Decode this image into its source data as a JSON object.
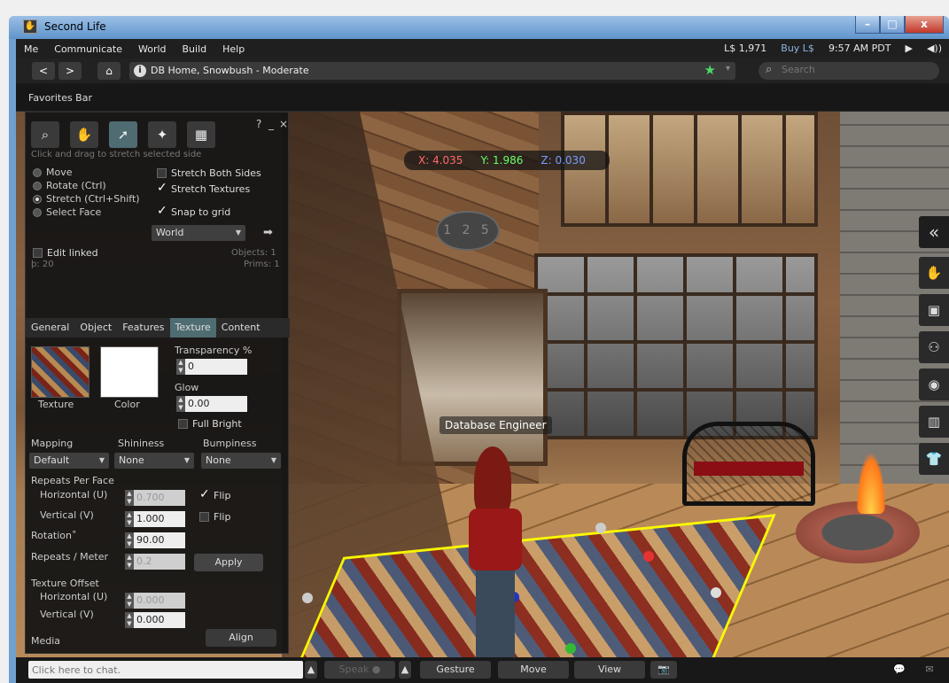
{
  "window": {
    "title": "Second Life",
    "app_icon": "second-life-hand-icon",
    "minimize": "–",
    "maximize": "□",
    "close": "x"
  },
  "menu": {
    "items": [
      "Me",
      "Communicate",
      "World",
      "Build",
      "Help"
    ],
    "balance": "L$ 1,971",
    "buy": "Buy L$",
    "time": "9:57 AM PDT",
    "play": "▶",
    "volume": "◀))"
  },
  "nav": {
    "back": "<",
    "forward": ">",
    "home": "⌂",
    "info": "i",
    "location": "DB Home, Snowbush - Moderate",
    "star": "★",
    "search_placeholder": "Search"
  },
  "favorites_bar": "Favorites Bar",
  "coords": {
    "x": "X: 4.035",
    "y": "Y: 1.986",
    "z": "Z: 0.030"
  },
  "scene": {
    "sign": "1 2 5",
    "nametag": "Database Engineer"
  },
  "build": {
    "help": "?",
    "minimize": "_",
    "close": "×",
    "hint": "Click and drag to stretch selected side",
    "modes": [
      "Move",
      "Rotate (Ctrl)",
      "Stretch (Ctrl+Shift)",
      "Select Face"
    ],
    "selected_mode": "Stretch (Ctrl+Shift)",
    "stretch_both_sides": "Stretch Both Sides",
    "stretch_textures": "Stretch Textures",
    "snap_to_grid": "Snap to grid",
    "grid_ruler": "World",
    "edit_linked": "Edit linked",
    "objects": "Objects: 1",
    "prims": "Prims: 1",
    "land_impact": "þ: 20",
    "tabs": [
      "General",
      "Object",
      "Features",
      "Texture",
      "Content"
    ],
    "active_tab": "Texture",
    "texture_label": "Texture",
    "color_label": "Color",
    "transparency_label": "Transparency %",
    "transparency_value": "0",
    "glow_label": "Glow",
    "glow_value": "0.00",
    "full_bright": "Full Bright",
    "mapping_label": "Mapping",
    "mapping_value": "Default",
    "shininess_label": "Shininess",
    "shininess_value": "None",
    "bumpiness_label": "Bumpiness",
    "bumpiness_value": "None",
    "repeats_per_face": "Repeats Per Face",
    "horizontal_u": "Horizontal (U)",
    "horizontal_u_value": "0.700",
    "vertical_v": "Vertical (V)",
    "vertical_v_value": "1.000",
    "flip": "Flip",
    "rotation_label": "Rotation˚",
    "rotation_value": "90.00",
    "repeats_meter_label": "Repeats / Meter",
    "repeats_meter_value": "0.2",
    "apply": "Apply",
    "texture_offset": "Texture Offset",
    "offset_u_value": "0.000",
    "offset_v_value": "0.000",
    "media_label": "Media",
    "add_media": "+",
    "align": "Align"
  },
  "sidebar": {
    "collapse": "«",
    "icons": [
      "hand-icon",
      "person-icon",
      "people-icon",
      "places-icon",
      "inventory-icon",
      "appearance-icon"
    ]
  },
  "bottom": {
    "chat_placeholder": "Click here to chat.",
    "speak": "Speak",
    "gesture": "Gesture",
    "move": "Move",
    "view": "View"
  }
}
